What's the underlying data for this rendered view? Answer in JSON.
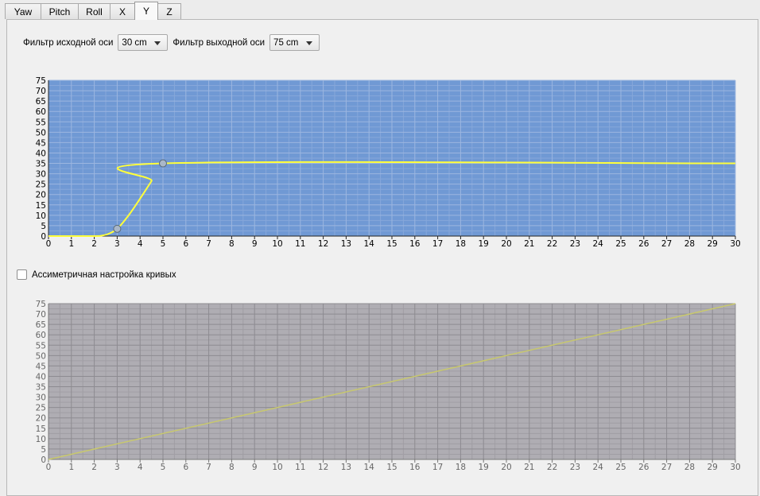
{
  "tabs": [
    {
      "label": "Yaw",
      "active": false
    },
    {
      "label": "Pitch",
      "active": false
    },
    {
      "label": "Roll",
      "active": false
    },
    {
      "label": "X",
      "active": false
    },
    {
      "label": "Y",
      "active": true
    },
    {
      "label": "Z",
      "active": false
    }
  ],
  "filters": {
    "source_label": "Фильтр исходной оси",
    "source_value": "30 cm",
    "output_label": "Фильтр выходной оси",
    "output_value": "75 cm"
  },
  "asymmetric": {
    "label": "Ассиметричная настройка кривых",
    "checked": false
  },
  "colors": {
    "top_plot_bg": "#7099d4",
    "bottom_plot_bg": "#afadb3",
    "curve_top": "#ffff3a",
    "curve_bottom": "#c8c86e",
    "point_fill": "#a9b7c8"
  },
  "chart_data": [
    {
      "type": "line",
      "xlim": [
        0,
        30
      ],
      "ylim": [
        0,
        75
      ],
      "x_ticks": [
        0,
        1,
        2,
        3,
        4,
        5,
        6,
        7,
        8,
        9,
        10,
        11,
        12,
        13,
        14,
        15,
        16,
        17,
        18,
        19,
        20,
        21,
        22,
        23,
        24,
        25,
        26,
        27,
        28,
        29,
        30
      ],
      "y_ticks": [
        0,
        5,
        10,
        15,
        20,
        25,
        30,
        35,
        40,
        45,
        50,
        55,
        60,
        65,
        70,
        75
      ],
      "grid": true,
      "control_points": [
        {
          "x": 3,
          "y": 3.5
        },
        {
          "x": 5,
          "y": 35
        }
      ],
      "series": [
        {
          "points": [
            [
              0,
              0
            ],
            [
              2,
              0
            ],
            [
              2.3,
              0.2
            ],
            [
              2.6,
              1
            ],
            [
              3,
              3.5
            ],
            [
              3.5,
              10
            ],
            [
              4,
              18
            ],
            [
              4.5,
              26.5
            ],
            [
              5,
              35
            ],
            [
              30,
              35
            ]
          ]
        }
      ]
    },
    {
      "type": "line",
      "xlim": [
        0,
        30
      ],
      "ylim": [
        0,
        75
      ],
      "x_ticks": [
        0,
        1,
        2,
        3,
        4,
        5,
        6,
        7,
        8,
        9,
        10,
        11,
        12,
        13,
        14,
        15,
        16,
        17,
        18,
        19,
        20,
        21,
        22,
        23,
        24,
        25,
        26,
        27,
        28,
        29,
        30
      ],
      "y_ticks": [
        0,
        5,
        10,
        15,
        20,
        25,
        30,
        35,
        40,
        45,
        50,
        55,
        60,
        65,
        70,
        75
      ],
      "grid": true,
      "series": [
        {
          "points": [
            [
              0,
              0
            ],
            [
              30,
              75
            ]
          ]
        }
      ]
    }
  ]
}
